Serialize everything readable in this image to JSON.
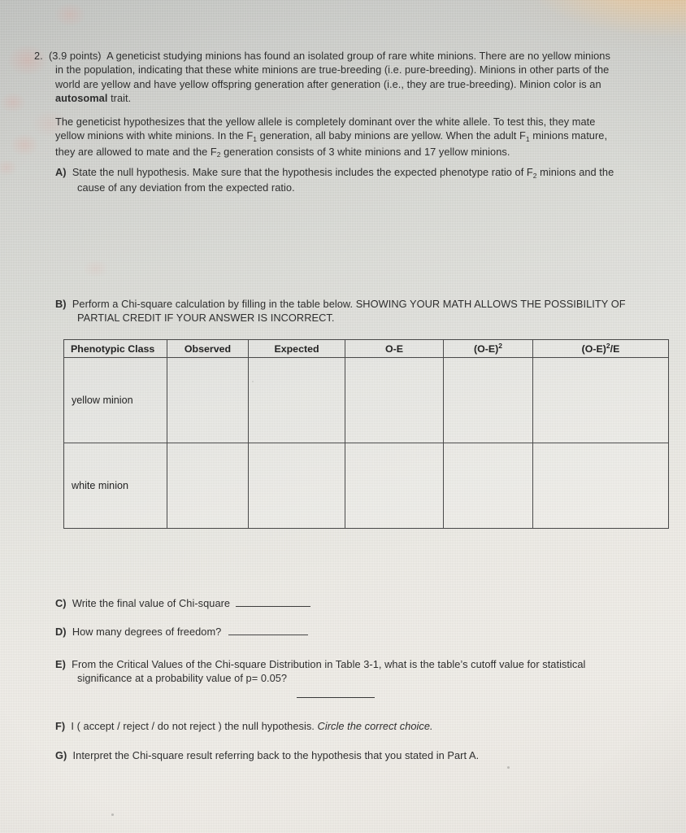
{
  "document": {
    "question_number": "2.",
    "points": "(3.9 points)",
    "intro_lines": [
      "A geneticist studying minions has found an isolated group of rare white minions.  There are no yellow minions",
      "in the population, indicating that these white minions are true-breeding (i.e. pure-breeding).  Minions in other parts of the",
      "world are yellow and have yellow offspring generation after generation (i.e., they are true-breeding).  Minion color is an",
      "trait."
    ],
    "intro_bold_word": "autosomal",
    "hypothesis_lines": [
      "The geneticist hypothesizes that the yellow allele is completely dominant over the white allele.  To test this, they mate",
      "yellow minions with white minions.  In the F",
      " generation, all baby minions are yellow.  When the adult F",
      " minions mature,",
      "they are allowed to mate and the F",
      " generation consists of 3 white minions and 17 yellow minions."
    ],
    "parts": {
      "a": {
        "label": "A)",
        "line1_pre": "State the null hypothesis.  Make sure that the hypothesis includes the expected phenotype ratio of F",
        "line1_sub": "2",
        "line1_post": " minions and the",
        "line2": "cause of any deviation from the expected ratio."
      },
      "b": {
        "label": "B)",
        "line1": "Perform a Chi-square calculation by filling in the table below.  SHOWING YOUR MATH ALLOWS THE POSSIBILITY OF",
        "line2": "PARTIAL CREDIT IF YOUR ANSWER IS INCORRECT."
      },
      "c": {
        "label": "C)",
        "text": "Write the final value of Chi-square"
      },
      "d": {
        "label": "D)",
        "text": "How many degrees of freedom?"
      },
      "e": {
        "label": "E)",
        "line1": "From the Critical Values of the Chi-square Distribution in Table 3-1, what is the table’s cutoff value for statistical",
        "line2": "significance at a probability value of p= 0.05?"
      },
      "f": {
        "label": "F)",
        "text_pre": "I  ( accept / reject / do not reject )  the null hypothesis.  ",
        "text_italic": "Circle the correct choice."
      },
      "g": {
        "label": "G)",
        "text": "Interpret the Chi-square result referring back to the hypothesis that you stated in Part A."
      }
    },
    "table": {
      "headers": [
        "Phenotypic Class",
        "Observed",
        "Expected",
        "O-E",
        "(O-E)",
        "(O-E)"
      ],
      "header_sup_5": "2",
      "header_6_sup": "2",
      "header_6_suffix": "/E",
      "rows": [
        {
          "phenotypic_class": "yellow minion",
          "observed": "",
          "expected": "",
          "o_minus_e": "",
          "o_minus_e_sq": "",
          "o_minus_e_sq_over_e": ""
        },
        {
          "phenotypic_class": "white minion",
          "observed": "",
          "expected": "",
          "o_minus_e": "",
          "o_minus_e_sq": "",
          "o_minus_e_sq_over_e": ""
        }
      ]
    },
    "subscripts": {
      "f1": "1",
      "f2": "2"
    },
    "colors": {
      "ink": "#2b2b2b",
      "table_border": "#4a4a4a",
      "paper_light": "#efece6",
      "paper_shadow": "#c3c5c2",
      "light_spill": "#f7c88c",
      "blotch_pink": "#e29688"
    }
  }
}
